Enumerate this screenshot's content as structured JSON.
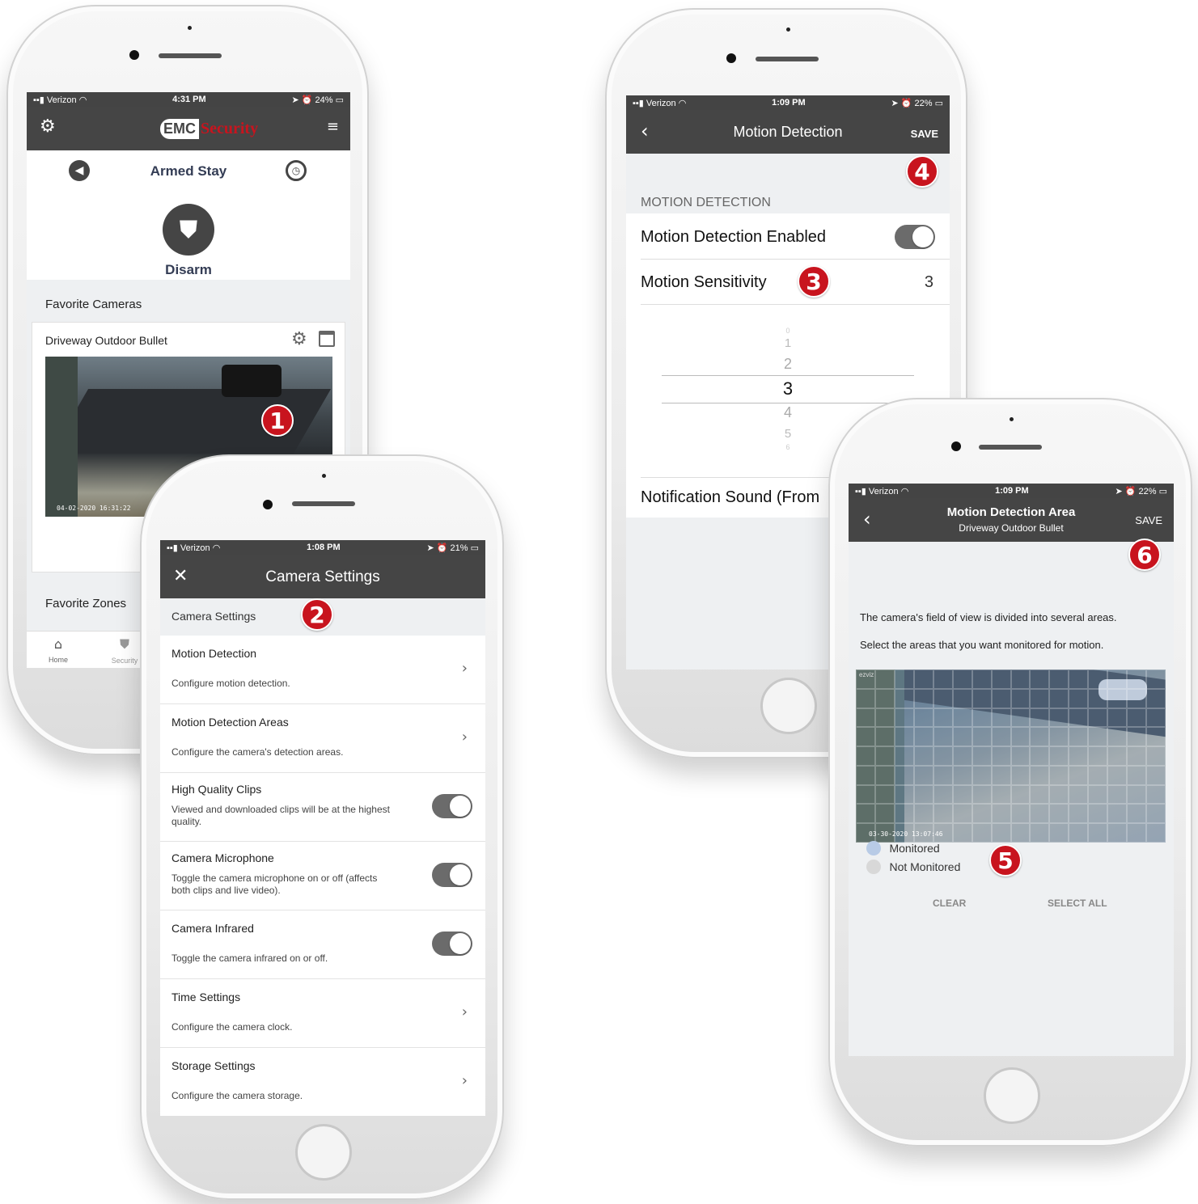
{
  "phone1": {
    "status": {
      "carrier": "Verizon",
      "time": "4:31 PM",
      "battery": "24%"
    },
    "brand": {
      "logo_emc": "EMC",
      "logo_security": "Security"
    },
    "arm_state": "Armed Stay",
    "disarm_label": "Disarm",
    "favorite_cameras_label": "Favorite Cameras",
    "camera_name": "Driveway Outdoor Bullet",
    "feed_timestamp": "04-02-2020 16:31:22",
    "favorite_zones_label": "Favorite Zones",
    "tabs": [
      {
        "label": "Home"
      },
      {
        "label": "Security"
      }
    ],
    "badge": "1"
  },
  "phone2": {
    "status": {
      "carrier": "Verizon",
      "time": "1:08 PM",
      "battery": "21%"
    },
    "title": "Camera Settings",
    "section_label": "Camera Settings",
    "badge": "2",
    "items": [
      {
        "title": "Motion Detection",
        "desc": "Configure motion detection.",
        "control": "chevron"
      },
      {
        "title": "Motion Detection Areas",
        "desc": "Configure the camera's detection areas.",
        "control": "chevron"
      },
      {
        "title": "High Quality Clips",
        "desc": "Viewed and downloaded clips will be at the highest quality.",
        "control": "toggle"
      },
      {
        "title": "Camera Microphone",
        "desc": "Toggle the camera microphone on or off (affects both clips and live video).",
        "control": "toggle"
      },
      {
        "title": "Camera Infrared",
        "desc": "Toggle the camera infrared on or off.",
        "control": "toggle"
      },
      {
        "title": "Time Settings",
        "desc": "Configure the camera clock.",
        "control": "chevron"
      },
      {
        "title": "Storage Settings",
        "desc": "Configure the camera storage.",
        "control": "chevron"
      }
    ]
  },
  "phone3": {
    "status": {
      "carrier": "Verizon",
      "time": "1:09 PM",
      "battery": "22%"
    },
    "title": "Motion Detection",
    "save_label": "SAVE",
    "section_label": "MOTION DETECTION",
    "enabled_label": "Motion Detection Enabled",
    "sensitivity_label": "Motion Sensitivity",
    "sensitivity_value": "3",
    "picker": [
      "0",
      "1",
      "2",
      "3",
      "4",
      "5",
      "6"
    ],
    "notification_label": "Notification Sound (From",
    "badge_sensitivity": "3",
    "badge_save": "4"
  },
  "phone4": {
    "status": {
      "carrier": "Verizon",
      "time": "1:09 PM",
      "battery": "22%"
    },
    "title": "Motion Detection Area",
    "subtitle": "Driveway Outdoor Bullet",
    "save_label": "SAVE",
    "instruction1": "The camera's field of view is divided into several areas.",
    "instruction2": "Select the areas that you want monitored for motion.",
    "watermark": "ezviz",
    "feed_timestamp": "03-30-2020 13:07:46",
    "legend_monitored": "Monitored",
    "legend_not_monitored": "Not Monitored",
    "clear_label": "CLEAR",
    "select_all_label": "SELECT ALL",
    "badge_legend": "5",
    "badge_save": "6",
    "colors": {
      "monitored": "#b8cbe6",
      "not_monitored": "#d8d8d8"
    }
  }
}
